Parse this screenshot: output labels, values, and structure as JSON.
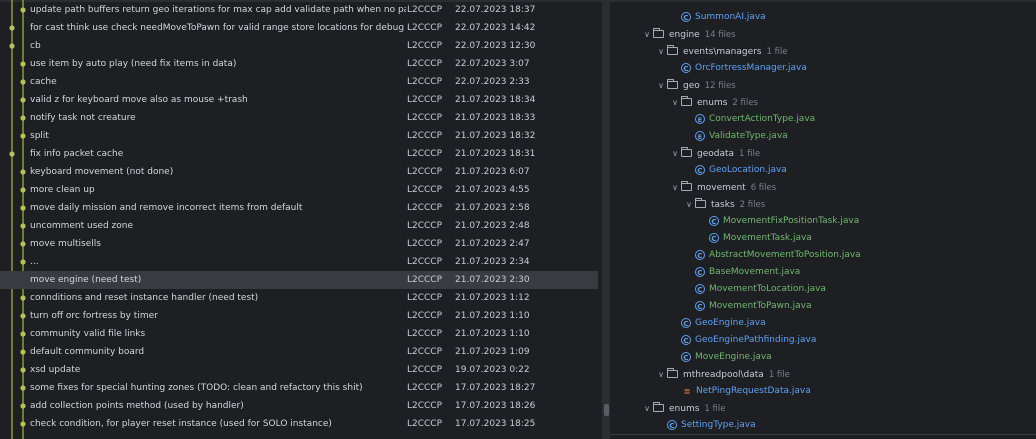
{
  "commits": [
    {
      "message": "update path buffers return geo iterations for max cap add validate path when no pathfinding",
      "author": "L2CCCP",
      "date": "22.07.2023 18:37"
    },
    {
      "message": "for cast think use check needMoveToPawn for valid range store locations for debug and",
      "author": "L2CCCP",
      "date": "22.07.2023 14:42"
    },
    {
      "message": "cb",
      "author": "L2CCCP",
      "date": "22.07.2023 12:30"
    },
    {
      "message": "use item by auto play (need fix items in data)",
      "author": "L2CCCP",
      "date": "22.07.2023 3:07"
    },
    {
      "message": "cache",
      "author": "L2CCCP",
      "date": "22.07.2023 2:33"
    },
    {
      "message": "valid z for keyboard move also as mouse +trash",
      "author": "L2CCCP",
      "date": "21.07.2023 18:34"
    },
    {
      "message": "notify task not creature",
      "author": "L2CCCP",
      "date": "21.07.2023 18:33"
    },
    {
      "message": "split",
      "author": "L2CCCP",
      "date": "21.07.2023 18:32"
    },
    {
      "message": "fix info packet cache",
      "author": "L2CCCP",
      "date": "21.07.2023 18:31"
    },
    {
      "message": "keyboard movement (not done)",
      "author": "L2CCCP",
      "date": "21.07.2023 6:07"
    },
    {
      "message": "more clean up",
      "author": "L2CCCP",
      "date": "21.07.2023 4:55"
    },
    {
      "message": "move daily mission and remove incorrect items from default",
      "author": "L2CCCP",
      "date": "21.07.2023 2:58"
    },
    {
      "message": "uncomment used zone",
      "author": "L2CCCP",
      "date": "21.07.2023 2:48"
    },
    {
      "message": "move multisells",
      "author": "L2CCCP",
      "date": "21.07.2023 2:47"
    },
    {
      "message": "...",
      "author": "L2CCCP",
      "date": "21.07.2023 2:34"
    },
    {
      "message": "move engine (need test)",
      "author": "L2CCCP",
      "date": "21.07.2023 2:30",
      "selected": true
    },
    {
      "message": "connditions and reset instance handler (need test)",
      "author": "L2CCCP",
      "date": "21.07.2023 1:12"
    },
    {
      "message": "turn off orc fortress by timer",
      "author": "L2CCCP",
      "date": "21.07.2023 1:10"
    },
    {
      "message": "community valid file links",
      "author": "L2CCCP",
      "date": "21.07.2023 1:10"
    },
    {
      "message": "default community board",
      "author": "L2CCCP",
      "date": "21.07.2023 1:09"
    },
    {
      "message": "xsd update",
      "author": "L2CCCP",
      "date": "19.07.2023 0:22"
    },
    {
      "message": "some fixes for special hunting zones (TODO: clean and refactory this shit)",
      "author": "L2CCCP",
      "date": "17.07.2023 18:27"
    },
    {
      "message": "add collection points method (used by handler)",
      "author": "L2CCCP",
      "date": "17.07.2023 18:26"
    },
    {
      "message": "check condition, for player reset instance (used for SOLO instance)",
      "author": "L2CCCP",
      "date": "17.07.2023 18:25"
    }
  ],
  "tree": [
    {
      "kind": "class",
      "icon": "class",
      "name": "SummonAI.java",
      "depth": 5,
      "color": "blue"
    },
    {
      "kind": "dir",
      "name": "engine",
      "count": "14 files",
      "depth": 3
    },
    {
      "kind": "dir",
      "name": "events\\managers",
      "count": "1 file",
      "depth": 4
    },
    {
      "kind": "class",
      "icon": "class",
      "name": "OrcFortressManager.java",
      "depth": 5,
      "color": "blue"
    },
    {
      "kind": "dir",
      "name": "geo",
      "count": "12 files",
      "depth": 4
    },
    {
      "kind": "dir",
      "name": "enums",
      "count": "2 files",
      "depth": 5
    },
    {
      "kind": "class",
      "icon": "enum",
      "name": "ConvertActionType.java",
      "depth": 6,
      "color": "green"
    },
    {
      "kind": "class",
      "icon": "enum",
      "name": "ValidateType.java",
      "depth": 6,
      "color": "green"
    },
    {
      "kind": "dir",
      "name": "geodata",
      "count": "1 file",
      "depth": 5
    },
    {
      "kind": "class",
      "icon": "class",
      "name": "GeoLocation.java",
      "depth": 6,
      "color": "blue"
    },
    {
      "kind": "dir",
      "name": "movement",
      "count": "6 files",
      "depth": 5
    },
    {
      "kind": "dir",
      "name": "tasks",
      "count": "2 files",
      "depth": 6
    },
    {
      "kind": "class",
      "icon": "class",
      "name": "MovementFixPositionTask.java",
      "depth": 7,
      "color": "green"
    },
    {
      "kind": "class",
      "icon": "class",
      "name": "MovementTask.java",
      "depth": 7,
      "color": "green"
    },
    {
      "kind": "class",
      "icon": "class",
      "name": "AbstractMovementToPosition.java",
      "depth": 6,
      "color": "green"
    },
    {
      "kind": "class",
      "icon": "class",
      "name": "BaseMovement.java",
      "depth": 6,
      "color": "green"
    },
    {
      "kind": "class",
      "icon": "class",
      "name": "MovementToLocation.java",
      "depth": 6,
      "color": "green"
    },
    {
      "kind": "class",
      "icon": "class",
      "name": "MovementToPawn.java",
      "depth": 6,
      "color": "green"
    },
    {
      "kind": "class",
      "icon": "class",
      "name": "GeoEngine.java",
      "depth": 5,
      "color": "blue"
    },
    {
      "kind": "class",
      "icon": "class",
      "name": "GeoEnginePathfinding.java",
      "depth": 5,
      "color": "blue"
    },
    {
      "kind": "class",
      "icon": "class",
      "name": "MoveEngine.java",
      "depth": 5,
      "color": "green"
    },
    {
      "kind": "dir",
      "name": "mthreadpool\\data",
      "count": "1 file",
      "depth": 4
    },
    {
      "kind": "class",
      "icon": "interface",
      "name": "NetPingRequestData.java",
      "depth": 5,
      "color": "blue"
    },
    {
      "kind": "dir",
      "name": "enums",
      "count": "1 file",
      "depth": 3
    },
    {
      "kind": "class",
      "icon": "class",
      "name": "SettingType.java",
      "depth": 4,
      "color": "blue"
    }
  ],
  "colors": {
    "graph_line": "#8e9a3a",
    "node": "#b8c25a",
    "accent_blue": "#5ea1f5",
    "accent_green": "#6fb86f"
  }
}
